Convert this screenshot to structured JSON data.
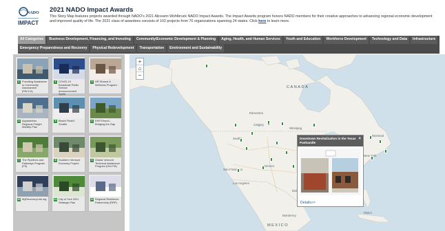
{
  "header": {
    "logo_text": "NADO IMPACT",
    "title": "2021 NADO Impact Awards",
    "description": "This Story Map features projects awarded through NADO's 2021 Aliceann Wohlbruck NADO Impact Awards. The Impact Awards program honors NADO members for their creative approaches to advancing regional economic development and improved quality of life. The 2021 class of awardees consists of 102 projects from 70 organizations spanning 24 states. Click ",
    "link_text": "here",
    "description_end": " to learn more."
  },
  "tabs": [
    {
      "label": "All Categories",
      "active": true
    },
    {
      "label": "Business Development, Financing, and Investing"
    },
    {
      "label": "Community/Economic Development & Planning"
    },
    {
      "label": "Aging, Health, and Human Services"
    },
    {
      "label": "Youth and Education"
    },
    {
      "label": "Workforce Development"
    },
    {
      "label": "Technology and Data"
    },
    {
      "label": "Infrastructure"
    },
    {
      "label": "Emergency Preparedness and Recovery"
    },
    {
      "label": "Physical Redevelopment"
    },
    {
      "label": "Transportation"
    },
    {
      "label": "Environment and Sustainability"
    }
  ],
  "cards": [
    {
      "num": "1",
      "title": "Providing Assistance to Community Assessment (PACCA)"
    },
    {
      "num": "2",
      "title": "COVID-19 Broadcast Public Service Announcement Spots"
    },
    {
      "num": "3",
      "title": "HR Shared & Wellness Program"
    },
    {
      "num": "4",
      "title": "Appalachian Regional Freight Mobility Plan"
    },
    {
      "num": "5",
      "title": "Beach Reach Shuttle"
    },
    {
      "num": "6",
      "title": "EKR Round - Bridging the Gap"
    },
    {
      "num": "7",
      "title": "The Pipelines and Pathways Program (P3)"
    },
    {
      "num": "8",
      "title": "Southern Vermont Economy Project"
    },
    {
      "num": "9",
      "title": "Global Vermont Technical Assistance Program (GloVTA)"
    },
    {
      "num": "10",
      "title": "MyRecoveryLink.org"
    },
    {
      "num": "11",
      "title": "City of York 2021 Strategic Plan"
    },
    {
      "num": "12",
      "title": "Regional Resilience Partnership (RRP)"
    }
  ],
  "map": {
    "zoom_in": "+",
    "home": "⌂",
    "zoom_out": "−",
    "labels": {
      "canada": "CANADA",
      "seattle": "Seattle",
      "vancouver": "Vancouver",
      "edmonton": "Edmonton",
      "calgary": "Calgary",
      "winnipeg": "Winnipeg",
      "montreal": "Montreal",
      "toronto": "Toronto",
      "chicago": "Chicago",
      "new_york": "New York",
      "denver": "Denver",
      "san_francisco": "San Francisco",
      "los_angeles": "Los Angeles",
      "dallas": "Dallas",
      "houston": "Houston",
      "atlanta": "Atlanta",
      "miami": "Miami",
      "monterrey": "Monterrey",
      "mexico": "MEXICO",
      "havana": "Havana",
      "ottawa": "Ottawa"
    }
  },
  "popup": {
    "title": "Downtown Revitalization in the Texas Panhandle",
    "close": "×",
    "link": "Details>>"
  },
  "colors": {
    "pin": "#2f8f3a",
    "tab_bg": "#5b5b5b",
    "tab_active": "#9c9c9c",
    "water": "#cfe0ea",
    "land": "#f1f0ea"
  }
}
